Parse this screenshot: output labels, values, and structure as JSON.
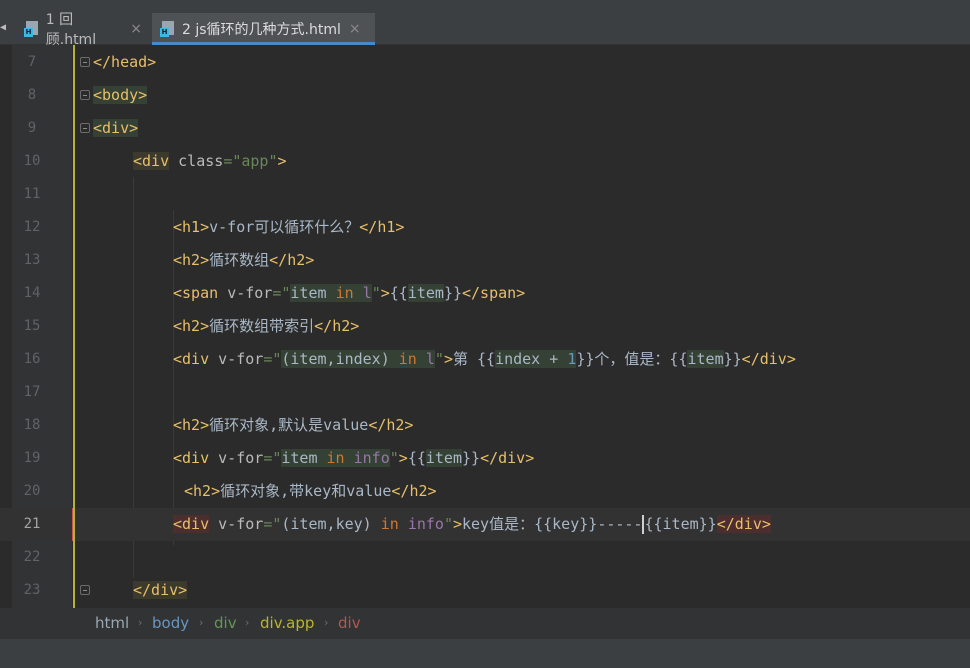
{
  "tabs": [
    {
      "label": "1 回顾.html",
      "active": false
    },
    {
      "label": "2 js循环的几种方式.html",
      "active": true
    }
  ],
  "icons": {
    "file": "html-file-icon",
    "close": "close-icon"
  },
  "colors": {
    "tag": "#e8bf6a",
    "string": "#6a8759",
    "keyword": "#cc7832",
    "identifier": "#9876aa",
    "number": "#6897bb",
    "text": "#a9b7c6",
    "accent": "#4a88c7",
    "error_marker": "#c75450"
  },
  "editor": {
    "lines": [
      {
        "num": "7",
        "t": [
          "</head>"
        ]
      },
      {
        "num": "8",
        "t": [
          "<body>"
        ]
      },
      {
        "num": "9",
        "t": [
          "<div>"
        ]
      },
      {
        "num": "10",
        "t": [
          "<div",
          "class",
          "=\"app\"",
          ">"
        ]
      },
      {
        "num": "11",
        "t": []
      },
      {
        "num": "12",
        "t": [
          "<h1>",
          "v-for可以循环什么？",
          "</h1>"
        ]
      },
      {
        "num": "13",
        "t": [
          "<h2>",
          "循环数组",
          "</h2>"
        ]
      },
      {
        "num": "14",
        "t": [
          "<span",
          "v-for",
          "=\"",
          "item",
          "in",
          "l",
          "\"",
          ">",
          "{{",
          "item",
          "}}",
          "</span>"
        ]
      },
      {
        "num": "15",
        "t": [
          "<h2>",
          "循环数组带索引",
          "</h2>"
        ]
      },
      {
        "num": "16",
        "t": [
          "<div",
          "v-for",
          "=\"",
          "(item,",
          "index)",
          "in",
          "l",
          "\"",
          ">",
          "第 ",
          "{{",
          "index + ",
          "1",
          "}}",
          "个，值是：",
          "{{",
          "item",
          "}}",
          "</div>"
        ]
      },
      {
        "num": "17",
        "t": []
      },
      {
        "num": "18",
        "t": [
          "<h2>",
          "循环对象,默认是value",
          "</h2>"
        ]
      },
      {
        "num": "19",
        "t": [
          "<div",
          "v-for",
          "=\"",
          "item",
          "in",
          "info",
          "\"",
          ">",
          "{{",
          "item",
          "}}",
          "</div>"
        ]
      },
      {
        "num": "20",
        "t": [
          "<h2>",
          "循环对象,带key和value",
          "</h2>"
        ]
      },
      {
        "num": "21",
        "t": [
          "<div",
          "v-for",
          "=\"",
          "(item,",
          "key)",
          "in",
          "info",
          "\"",
          ">",
          "key值是：",
          "{{",
          "key",
          "}}",
          "-----",
          "{{",
          "item",
          "}}",
          "</div>"
        ]
      },
      {
        "num": "22",
        "t": []
      },
      {
        "num": "23",
        "t": [
          "</div>"
        ]
      }
    ]
  },
  "breadcrumb": [
    "html",
    "body",
    "div",
    "div.app",
    "div"
  ]
}
